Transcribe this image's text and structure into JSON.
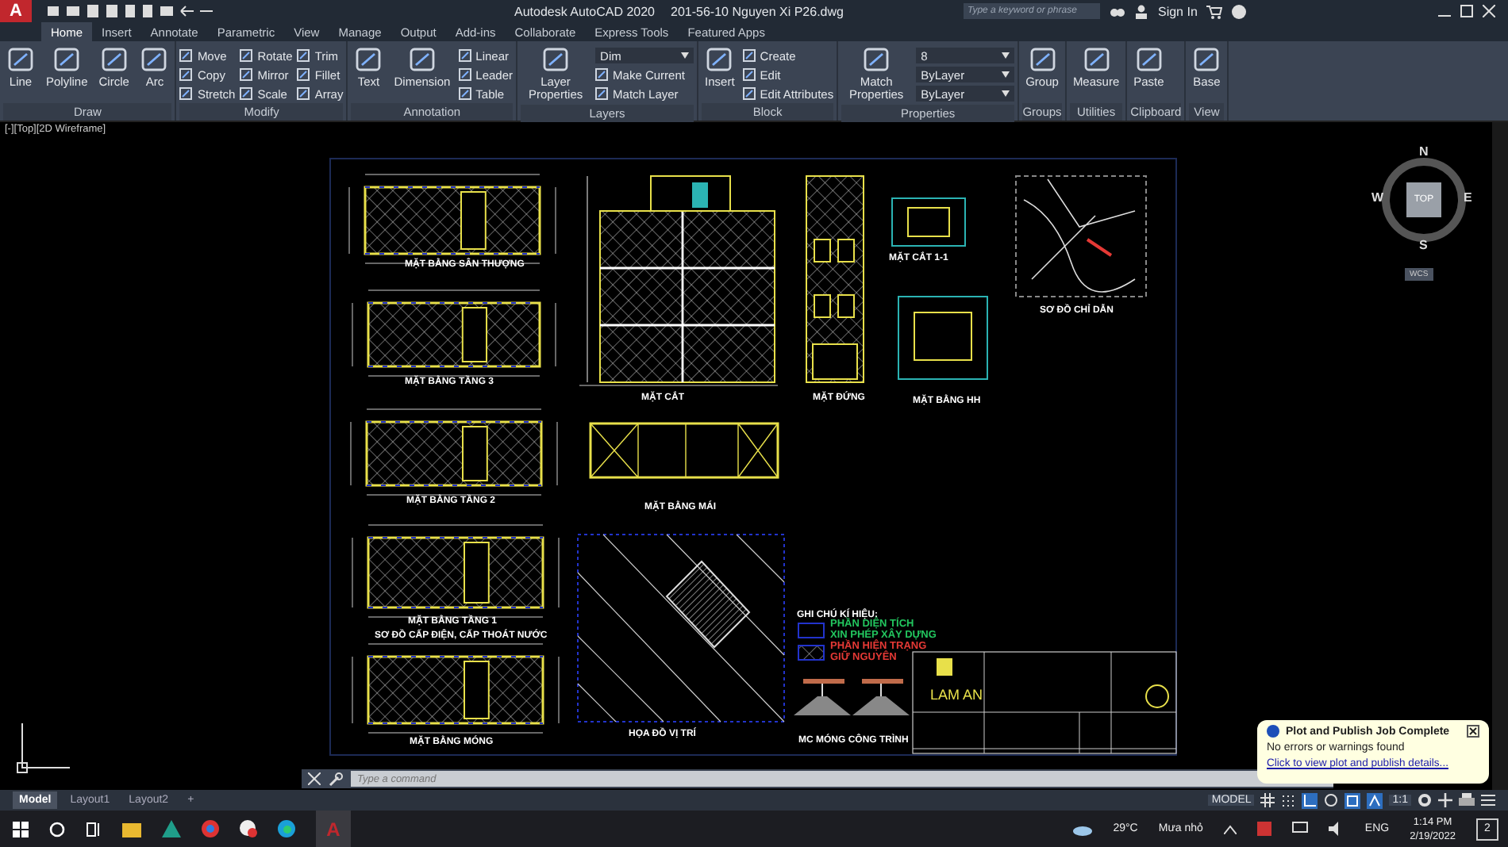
{
  "app_button": {
    "label": "A"
  },
  "window": {
    "title": "Autodesk AutoCAD 2020",
    "file": "201-56-10 Nguyen Xi P26.dwg"
  },
  "search": {
    "placeholder": "Type a keyword or phrase"
  },
  "sign_in": "Sign In",
  "tabs": [
    {
      "label": "Home",
      "selected": true
    },
    {
      "label": "Insert",
      "selected": false
    },
    {
      "label": "Annotate",
      "selected": false
    },
    {
      "label": "Parametric",
      "selected": false
    },
    {
      "label": "View",
      "selected": false
    },
    {
      "label": "Manage",
      "selected": false
    },
    {
      "label": "Output",
      "selected": false
    },
    {
      "label": "Add-ins",
      "selected": false
    },
    {
      "label": "Collaborate",
      "selected": false
    },
    {
      "label": "Express Tools",
      "selected": false
    },
    {
      "label": "Featured Apps",
      "selected": false
    }
  ],
  "panels": [
    {
      "title": "Draw",
      "tools": [
        {
          "kind": "large",
          "label": "Line"
        },
        {
          "kind": "large",
          "label": "Polyline"
        },
        {
          "kind": "large",
          "label": "Circle"
        },
        {
          "kind": "large",
          "label": "Arc"
        }
      ]
    },
    {
      "title": "Modify",
      "tools": [
        {
          "kind": "small",
          "label": "Move"
        },
        {
          "kind": "small",
          "label": "Copy"
        },
        {
          "kind": "small",
          "label": "Stretch"
        },
        {
          "kind": "small",
          "label": "Rotate"
        },
        {
          "kind": "small",
          "label": "Mirror"
        },
        {
          "kind": "small",
          "label": "Scale"
        },
        {
          "kind": "small",
          "label": "Trim"
        },
        {
          "kind": "small",
          "label": "Fillet"
        },
        {
          "kind": "small",
          "label": "Array"
        }
      ]
    },
    {
      "title": "Annotation",
      "tools": [
        {
          "kind": "large",
          "label": "Text"
        },
        {
          "kind": "large",
          "label": "Dimension"
        },
        {
          "kind": "small",
          "label": "Linear"
        },
        {
          "kind": "small",
          "label": "Leader"
        },
        {
          "kind": "small",
          "label": "Table"
        }
      ]
    },
    {
      "title": "Layers",
      "tools": [
        {
          "kind": "large",
          "label": "Layer Properties"
        },
        {
          "kind": "dropdown",
          "label": "Dim"
        },
        {
          "kind": "small",
          "label": "Make Current"
        },
        {
          "kind": "small",
          "label": "Match Layer"
        }
      ]
    },
    {
      "title": "Block",
      "tools": [
        {
          "kind": "large",
          "label": "Insert"
        },
        {
          "kind": "small",
          "label": "Create"
        },
        {
          "kind": "small",
          "label": "Edit"
        },
        {
          "kind": "small",
          "label": "Edit Attributes"
        }
      ]
    },
    {
      "title": "Properties",
      "tools": [
        {
          "kind": "large",
          "label": "Match Properties"
        },
        {
          "kind": "dropdown",
          "label": "8"
        },
        {
          "kind": "dropdown",
          "label": "ByLayer"
        },
        {
          "kind": "dropdown",
          "label": "ByLayer"
        }
      ]
    },
    {
      "title": "Groups",
      "tools": [
        {
          "kind": "large",
          "label": "Group"
        }
      ]
    },
    {
      "title": "Utilities",
      "tools": [
        {
          "kind": "large",
          "label": "Measure"
        }
      ]
    },
    {
      "title": "Clipboard",
      "tools": [
        {
          "kind": "large",
          "label": "Paste"
        }
      ]
    },
    {
      "title": "View",
      "tools": [
        {
          "kind": "large",
          "label": "Base"
        }
      ]
    }
  ],
  "viewport": {
    "label": "[-][Top][2D Wireframe]"
  },
  "viewcube": {
    "north": "N",
    "west": "W",
    "east": "E",
    "south": "S",
    "face": "TOP",
    "ucs": "WCS"
  },
  "drawing_labels": [
    {
      "text": "MẶT BẰNG SÂN THƯỢNG"
    },
    {
      "text": "MẶT BẰNG TẦNG 3"
    },
    {
      "text": "MẶT BẰNG TẦNG 2"
    },
    {
      "text": "MẶT BẰNG TẦNG 1"
    },
    {
      "text": "SƠ ĐỒ CẤP ĐIỆN, CẤP THOÁT NƯỚC"
    },
    {
      "text": "MẶT BẰNG MÓNG"
    },
    {
      "text": "MẶT CẮT"
    },
    {
      "text": "MẶT ĐỨNG"
    },
    {
      "text": "MẶT BẰNG MÁI"
    },
    {
      "text": "MẶT CẮT 1-1"
    },
    {
      "text": "MẶT BẰNG HH"
    },
    {
      "text": "SƠ ĐỒ CHỈ DẪN"
    },
    {
      "text": "GHI CHÚ KÍ HIỆU:"
    },
    {
      "text": "LAM AN"
    },
    {
      "text": "HỌA ĐỒ VỊ TRÍ"
    },
    {
      "text": "MC MÓNG CÔNG TRÌNH"
    }
  ],
  "legend": [
    {
      "text": "PHẦN DIỆN TÍCH",
      "color": "#22c55e"
    },
    {
      "text": "XIN PHÉP XÂY DỰNG",
      "color": "#22c55e"
    },
    {
      "text": "PHẦN HIỆN TRẠNG",
      "color": "#e53935"
    },
    {
      "text": "GIỮ NGUYÊN",
      "color": "#e53935"
    }
  ],
  "layout_tabs": [
    {
      "label": "Model",
      "selected": true
    },
    {
      "label": "Layout1",
      "selected": false
    },
    {
      "label": "Layout2",
      "selected": false
    }
  ],
  "add_layout": "+",
  "command": {
    "placeholder": "Type a command"
  },
  "status": {
    "space": "MODEL",
    "scale": "1:1"
  },
  "notification": {
    "title": "Plot and Publish Job Complete",
    "message": "No errors or warnings found",
    "link": "Click to view plot and publish details..."
  },
  "taskbar": {
    "active_app": "A",
    "weather": "29°C",
    "weather_text": "Mưa nhỏ",
    "language": "ENG",
    "time": "1:14 PM",
    "date": "2/19/2022",
    "notifications": "2"
  }
}
